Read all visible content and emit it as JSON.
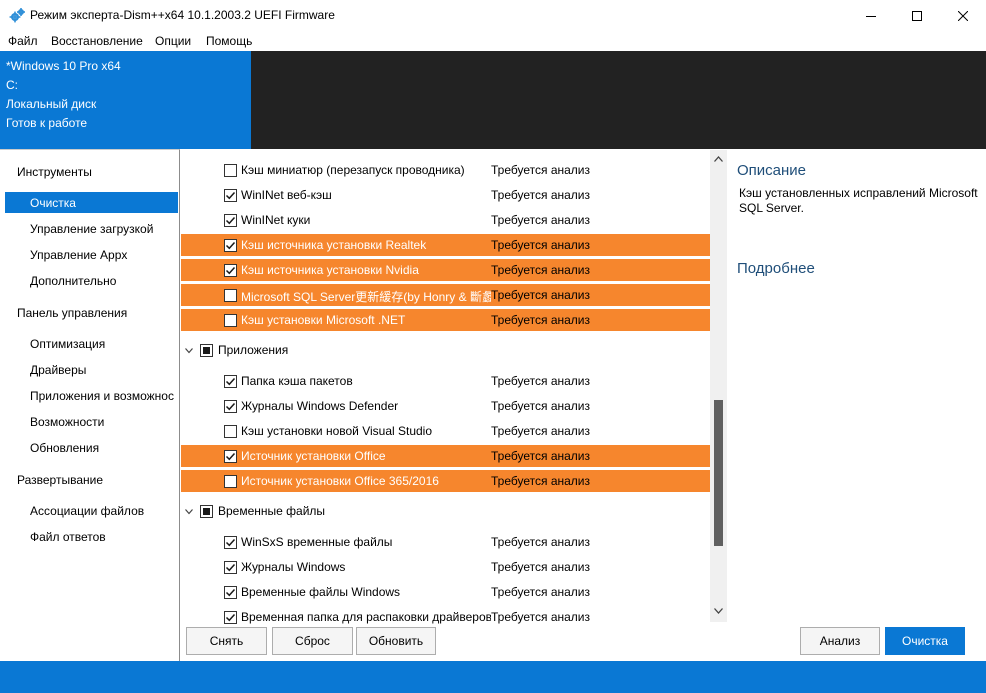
{
  "window": {
    "title": "Режим эксперта-Dism++x64 10.1.2003.2 UEFI Firmware",
    "icons": {
      "app": "gears-icon",
      "minimize": "minimize-icon",
      "maximize": "maximize-icon",
      "close": "close-icon"
    }
  },
  "menu": [
    "Файл",
    "Восстановление",
    "Опции",
    "Помощь"
  ],
  "header": {
    "os": "*Windows 10 Pro x64",
    "drive": "C:",
    "disk": "Локальный диск",
    "status": "Готов к работе"
  },
  "sidebar": {
    "groups": [
      {
        "label": "Инструменты",
        "items": [
          "Очистка",
          "Управление загрузкой",
          "Управление Appx",
          "Дополнительно"
        ]
      },
      {
        "label": "Панель управления",
        "items": [
          "Оптимизация",
          "Драйверы",
          "Приложения и возможнос",
          "Возможности",
          "Обновления"
        ]
      },
      {
        "label": "Развертывание",
        "items": [
          "Ассоциации файлов",
          "Файл ответов"
        ]
      }
    ],
    "selected": "Очистка"
  },
  "list": {
    "rows": [
      {
        "label": "Кэш миниатюр (перезапуск проводника)",
        "status": "Требуется анализ",
        "checked": false,
        "highlighted": false
      },
      {
        "label": "WinINet веб-кэш",
        "status": "Требуется анализ",
        "checked": true,
        "highlighted": false
      },
      {
        "label": "WinINet куки",
        "status": "Требуется анализ",
        "checked": true,
        "highlighted": false
      },
      {
        "label": "Кэш источника установки Realtek",
        "status": "Требуется анализ",
        "checked": true,
        "highlighted": true
      },
      {
        "label": "Кэш источника установки Nvidia",
        "status": "Требуется анализ",
        "checked": true,
        "highlighted": true
      },
      {
        "label": "Microsoft SQL Server更新緩存(by Honry & 斷蠡",
        "status": "Требуется анализ",
        "checked": false,
        "highlighted": true
      },
      {
        "label": "Кэш установки Microsoft .NET",
        "status": "Требуется анализ",
        "checked": false,
        "highlighted": true
      },
      {
        "group": "Приложения"
      },
      {
        "label": "Папка кэша пакетов",
        "status": "Требуется анализ",
        "checked": true,
        "highlighted": false
      },
      {
        "label": "Журналы Windows Defender",
        "status": "Требуется анализ",
        "checked": true,
        "highlighted": false
      },
      {
        "label": "Кэш установки новой Visual Studio",
        "status": "Требуется анализ",
        "checked": false,
        "highlighted": false
      },
      {
        "label": "Источник установки Office",
        "status": "Требуется анализ",
        "checked": true,
        "highlighted": true
      },
      {
        "label": "Источник установки Office 365/2016",
        "status": "Требуется анализ",
        "checked": false,
        "highlighted": true
      },
      {
        "group": "Временные файлы"
      },
      {
        "label": "WinSxS временные файлы",
        "status": "Требуется анализ",
        "checked": true,
        "highlighted": false
      },
      {
        "label": "Журналы Windows",
        "status": "Требуется анализ",
        "checked": true,
        "highlighted": false
      },
      {
        "label": "Временные файлы Windows",
        "status": "Требуется анализ",
        "checked": true,
        "highlighted": false
      },
      {
        "label": "Временная папка для распаковки драйверов",
        "status": "Требуется анализ",
        "checked": true,
        "highlighted": false
      }
    ],
    "highlight_color": "#f6862d"
  },
  "description": {
    "title": "Описание",
    "text": "Кэш установленных исправлений Microsoft SQL Server.",
    "more": "Подробнее"
  },
  "buttons": {
    "uncheck": "Снять",
    "reset": "Сброс",
    "refresh": "Обновить",
    "analyze": "Анализ",
    "clean": "Очистка"
  },
  "colors": {
    "accent": "#0a78d4",
    "header_dark": "#222222"
  }
}
